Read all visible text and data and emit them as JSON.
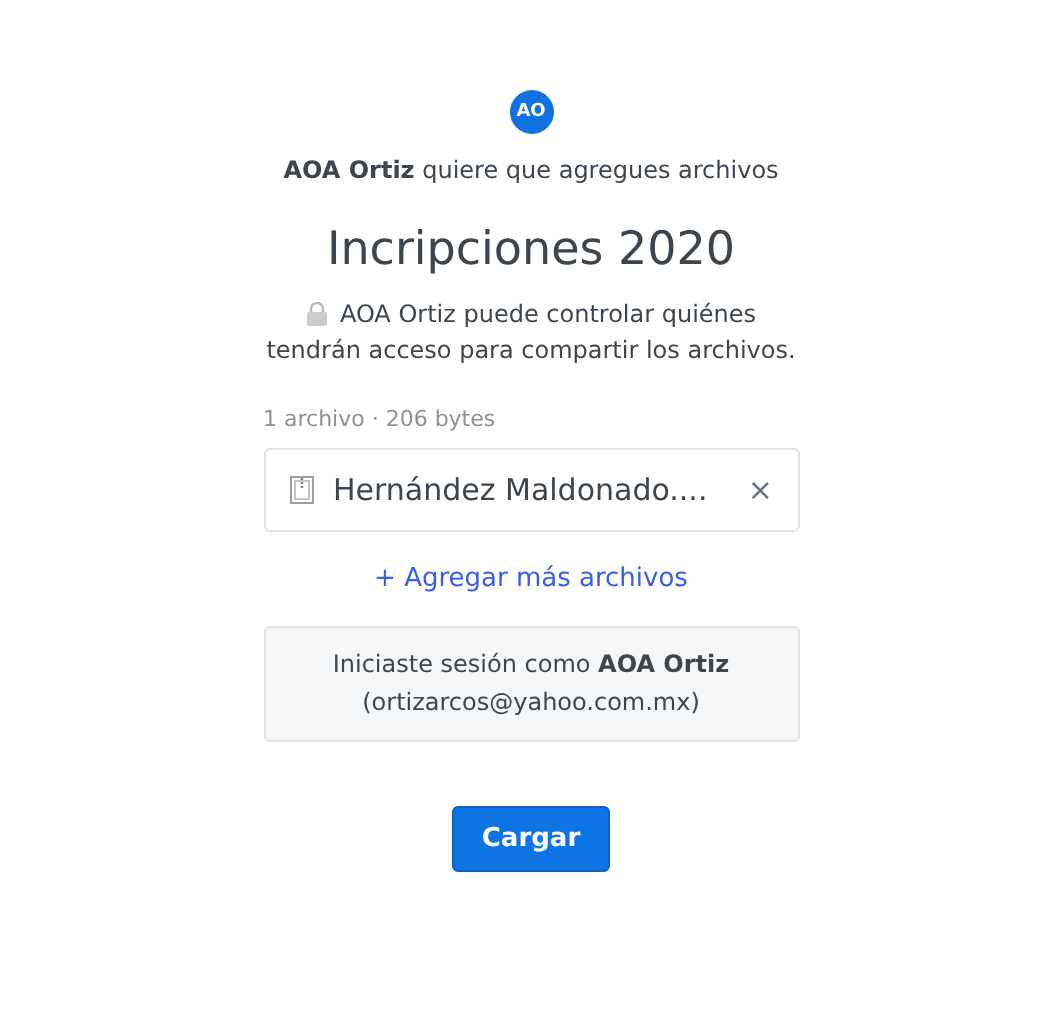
{
  "requester": {
    "initials": "AO",
    "message": "**AOA Ortiz** quiere que agregues archivos"
  },
  "title": "Incripciones 2020",
  "privacy_note_lines": [
    "AOA Ortiz puede controlar quiénes",
    "tendrán acceso para compartir los archivos."
  ],
  "file_summary": "1 archivo · 206 bytes",
  "files": [
    {
      "name": "Hernández Maldonado....",
      "remove": "×"
    }
  ],
  "add_more_link": "+ Agregar más archivos",
  "signed_in": "Iniciaste sesión como **AOA Ortiz** (ortizarcos@yahoo.com.mx)",
  "upload_button": "Cargar"
}
